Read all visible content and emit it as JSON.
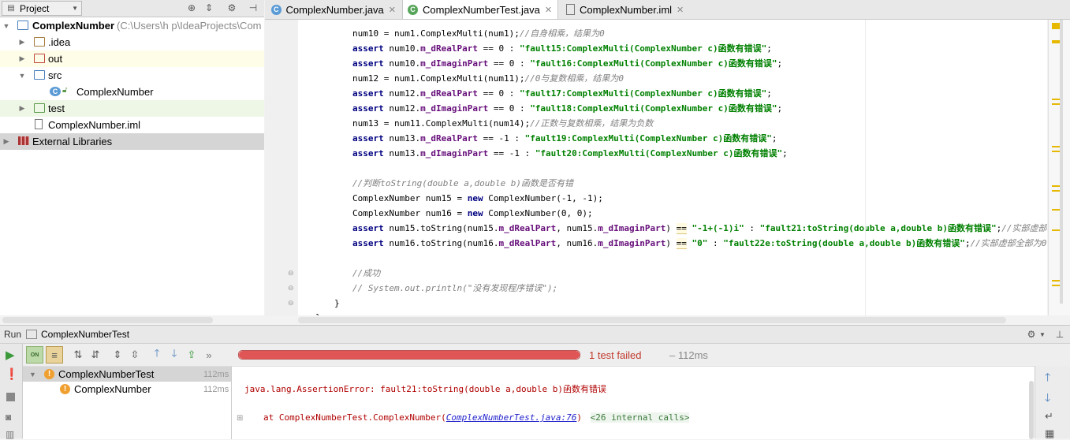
{
  "project_panel": {
    "title": "Project",
    "tree": [
      {
        "label": "ComplexNumber",
        "path": "(C:\\Users\\h p\\IdeaProjects\\Com",
        "type": "module"
      },
      {
        "label": ".idea",
        "type": "folder"
      },
      {
        "label": "out",
        "type": "folder-excluded"
      },
      {
        "label": "src",
        "type": "folder-source"
      },
      {
        "label": "ComplexNumber",
        "type": "class"
      },
      {
        "label": "test",
        "type": "folder-test"
      },
      {
        "label": "ComplexNumber.iml",
        "type": "file"
      },
      {
        "label": "External Libraries",
        "type": "libraries"
      }
    ]
  },
  "tabs": [
    {
      "label": "ComplexNumber.java",
      "active": false
    },
    {
      "label": "ComplexNumberTest.java",
      "active": true
    },
    {
      "label": "ComplexNumber.iml",
      "active": false
    }
  ],
  "code": {
    "l1": {
      "a": "num10 = num1.ComplexMulti(num1);",
      "c": "//自身相乘，结果为0"
    },
    "l2": {
      "kw": "assert",
      "v": " num10.",
      "f": "m_dRealPart",
      "op": " == 0 : ",
      "s": "\"fault15:ComplexMulti(ComplexNumber c)函数有错误\"",
      "e": ";"
    },
    "l3": {
      "kw": "assert",
      "v": " num10.",
      "f": "m_dImaginPart",
      "op": " == 0 : ",
      "s": "\"fault16:ComplexMulti(ComplexNumber c)函数有错误\"",
      "e": ";"
    },
    "l4": {
      "a": "num12 = num1.ComplexMulti(num11);",
      "c": "//0与复数相乘，结果为0"
    },
    "l5": {
      "kw": "assert",
      "v": " num12.",
      "f": "m_dRealPart",
      "op": " == 0 : ",
      "s": "\"fault17:ComplexMulti(ComplexNumber c)函数有错误\"",
      "e": ";"
    },
    "l6": {
      "kw": "assert",
      "v": " num12.",
      "f": "m_dImaginPart",
      "op": " == 0 : ",
      "s": "\"fault18:ComplexMulti(ComplexNumber c)函数有错误\"",
      "e": ";"
    },
    "l7": {
      "a": "num13 = num11.ComplexMulti(num14);",
      "c": "//正数与复数相乘，结果为负数"
    },
    "l8": {
      "kw": "assert",
      "v": " num13.",
      "f": "m_dRealPart",
      "op": " == -1 : ",
      "s": "\"fault19:ComplexMulti(ComplexNumber c)函数有错误\"",
      "e": ";"
    },
    "l9": {
      "kw": "assert",
      "v": " num13.",
      "f": "m_dImaginPart",
      "op": " == -1 : ",
      "s": "\"fault20:ComplexMulti(ComplexNumber c)函数有错误\"",
      "e": ";"
    },
    "l10": {
      "c": "//判断toString(double a,double b)函数是否有错"
    },
    "l11": {
      "a": "ComplexNumber num15 = ",
      "kw": "new",
      "b": " ComplexNumber(-1, -1);"
    },
    "l12": {
      "a": "ComplexNumber num16 = ",
      "kw": "new",
      "b": " ComplexNumber(0, 0);"
    },
    "l13": {
      "kw": "assert",
      "v": " num15.toString(num15.",
      "f": "m_dRealPart",
      "v2": ", num15.",
      "f2": "m_dImaginPart",
      "p": ") ",
      "eq": "==",
      "s": " \"-1+(-1)i\"",
      "op": " : ",
      "s2": "\"fault21:toString(double a,double b)函数有错误\"",
      "e": ";",
      "c": "//实部虚部"
    },
    "l14": {
      "kw": "assert",
      "v": " num16.toString(num16.",
      "f": "m_dRealPart",
      "v2": ", num16.",
      "f2": "m_dImaginPart",
      "p": ") ",
      "eq": "==",
      "s": " \"0\"",
      "op": " : ",
      "s2": "\"fault22e:toString(double a,double b)函数有错误\"",
      "e": ";",
      "c": "//实部虚部全部为0"
    },
    "l15": {
      "c": "//成功"
    },
    "l16": {
      "c": "// System.out.println(\"没有发现程序错误\");"
    },
    "l17": {
      "a": "}"
    },
    "l18": {
      "a": "}"
    }
  },
  "run_panel": {
    "label": "Run",
    "config": "ComplexNumberTest",
    "status": "1 test failed",
    "duration": "– 112ms",
    "progress_fraction": 1.0,
    "tests": [
      {
        "name": "ComplexNumberTest",
        "time": "112ms",
        "status": "failed"
      },
      {
        "name": "ComplexNumber",
        "time": "112ms",
        "status": "failed"
      }
    ],
    "console": {
      "error": "java.lang.AssertionError: fault21:toString(double a,double b)函数有错误",
      "at_prefix": "at ComplexNumberTest.ComplexNumber(",
      "link": "ComplexNumberTest.java:76",
      "at_suffix": ")",
      "internal": "<26 internal calls>"
    }
  },
  "colors": {
    "error": "#c0392b",
    "progress": "#e05555",
    "string": "#008000",
    "keyword": "#000080",
    "field": "#660e7a",
    "comment": "#808080"
  }
}
